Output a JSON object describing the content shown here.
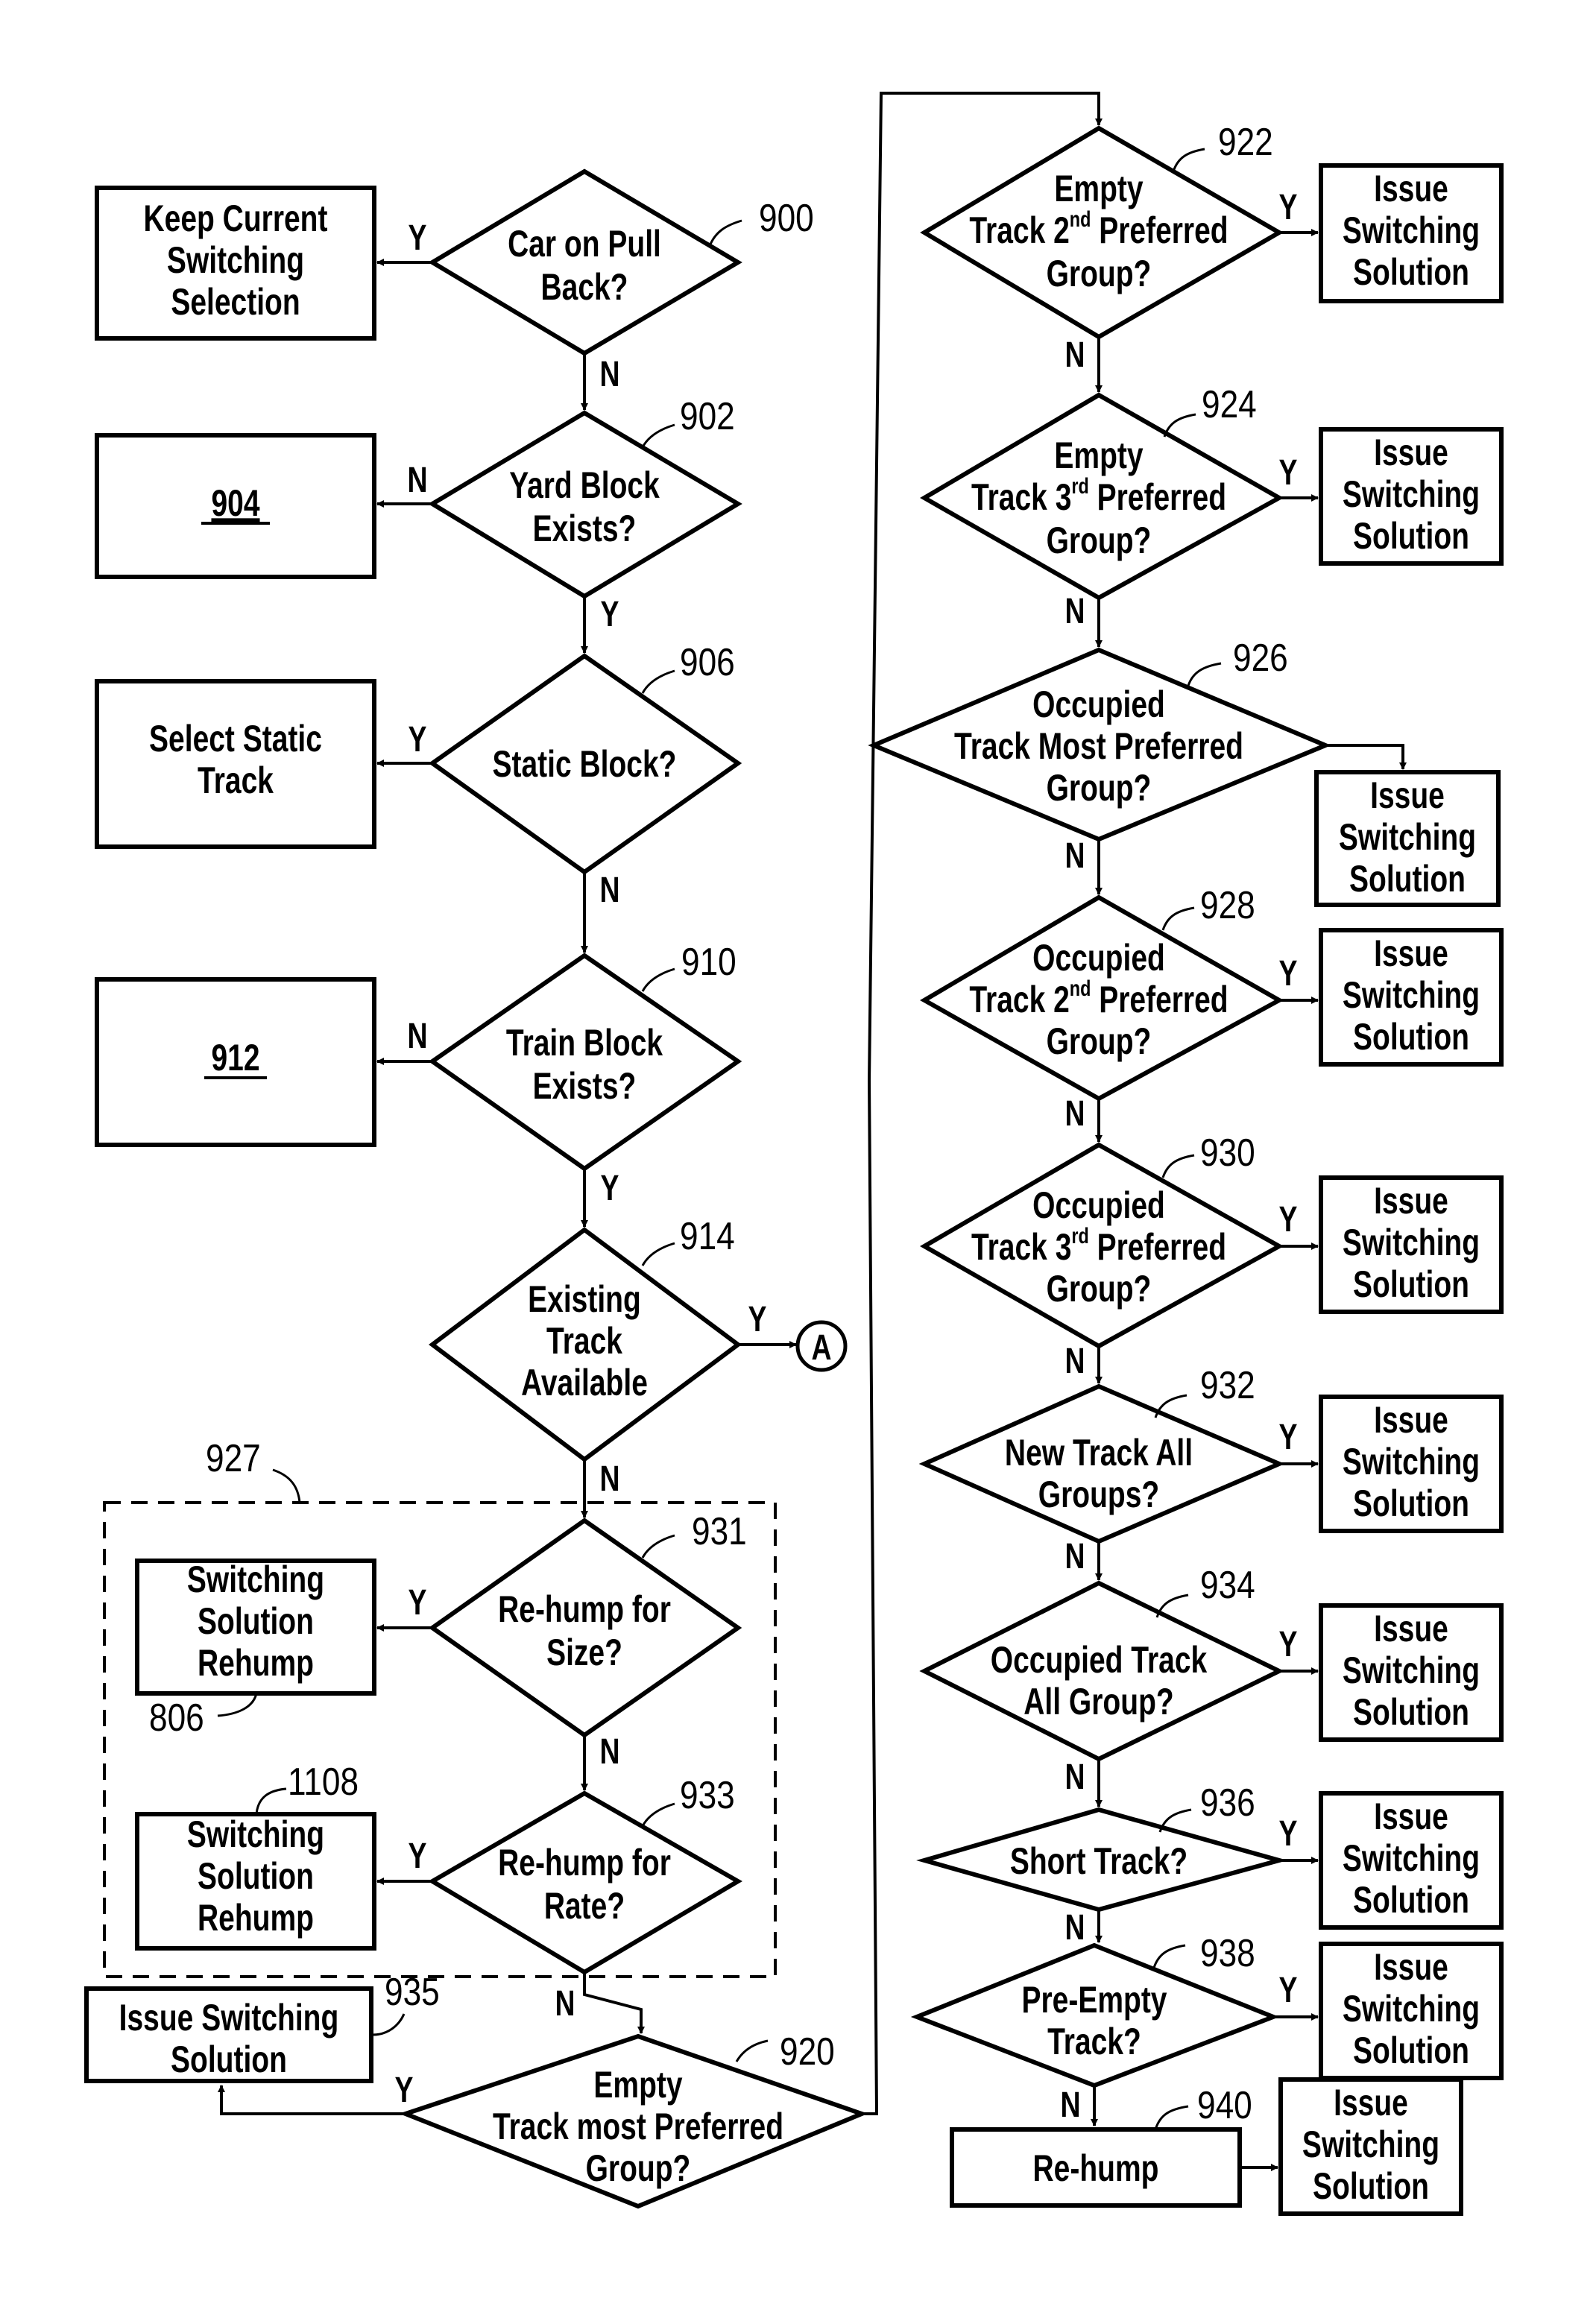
{
  "figure": {
    "type": "flowchart",
    "nodes": {
      "n900": {
        "ref": "900",
        "kind": "decision",
        "lines": [
          "Car on Pull",
          "Back?"
        ]
      },
      "keep_current": {
        "kind": "process",
        "lines": [
          "Keep Current",
          "Switching",
          "Selection"
        ]
      },
      "n902": {
        "ref": "902",
        "kind": "decision",
        "lines": [
          "Yard Block",
          "Exists?"
        ]
      },
      "n904": {
        "ref": "904",
        "kind": "process",
        "label": "904"
      },
      "n906": {
        "ref": "906",
        "kind": "decision",
        "lines": [
          "Static Block?"
        ]
      },
      "select_static": {
        "kind": "process",
        "lines": [
          "Select Static",
          "Track"
        ]
      },
      "n910": {
        "ref": "910",
        "kind": "decision",
        "lines": [
          "Train Block",
          "Exists?"
        ]
      },
      "n912": {
        "ref": "912",
        "kind": "process",
        "label": "912"
      },
      "n914": {
        "ref": "914",
        "kind": "decision",
        "lines": [
          "Existing",
          "Track",
          "Available"
        ]
      },
      "connector_a": {
        "kind": "connector",
        "label": "A"
      },
      "group927": {
        "ref": "927",
        "kind": "group"
      },
      "n931": {
        "ref": "931",
        "kind": "decision",
        "lines": [
          "Re-hump for",
          "Size?"
        ]
      },
      "n806": {
        "ref": "806",
        "kind": "process",
        "lines": [
          "Switching",
          "Solution",
          "Rehump"
        ]
      },
      "n933": {
        "ref": "933",
        "kind": "decision",
        "lines": [
          "Re-hump for",
          "Rate?"
        ]
      },
      "n1108": {
        "ref": "1108",
        "kind": "process",
        "lines": [
          "Switching",
          "Solution",
          "Rehump"
        ]
      },
      "n935": {
        "ref": "935",
        "kind": "process",
        "lines": [
          "Issue Switching",
          "Solution"
        ]
      },
      "n920": {
        "ref": "920",
        "kind": "decision",
        "lines": [
          "Empty",
          "Track most Preferred",
          "Group?"
        ]
      },
      "n922": {
        "ref": "922",
        "kind": "decision",
        "line1": "Empty",
        "line2_pre": "Track 2",
        "line2_sup": "nd",
        "line2_post": " Preferred",
        "line3": "Group?"
      },
      "n924": {
        "ref": "924",
        "kind": "decision",
        "line1": "Empty",
        "line2_pre": "Track 3",
        "line2_sup": "rd",
        "line2_post": " Preferred",
        "line3": "Group?"
      },
      "n926": {
        "ref": "926",
        "kind": "decision",
        "lines": [
          "Occupied",
          "Track Most Preferred",
          "Group?"
        ]
      },
      "n928": {
        "ref": "928",
        "kind": "decision",
        "line1": "Occupied",
        "line2_pre": "Track 2",
        "line2_sup": "nd",
        "line2_post": " Preferred",
        "line3": "Group?"
      },
      "n930": {
        "ref": "930",
        "kind": "decision",
        "line1": "Occupied",
        "line2_pre": "Track 3",
        "line2_sup": "rd",
        "line2_post": " Preferred",
        "line3": "Group?"
      },
      "n932": {
        "ref": "932",
        "kind": "decision",
        "lines": [
          "New Track All",
          "Groups?"
        ]
      },
      "n934": {
        "ref": "934",
        "kind": "decision",
        "lines": [
          "Occupied Track",
          "All Group?"
        ]
      },
      "n936": {
        "ref": "936",
        "kind": "decision",
        "lines": [
          "Short Track?"
        ]
      },
      "n938": {
        "ref": "938",
        "kind": "decision",
        "lines": [
          "Pre-Empty",
          "Track?"
        ]
      },
      "n940": {
        "ref": "940",
        "kind": "process",
        "lines": [
          "Re-hump"
        ]
      },
      "issue_box": {
        "kind": "process",
        "lines": [
          "Issue",
          "Switching",
          "Solution"
        ]
      }
    },
    "edge_labels": {
      "yes": "Y",
      "no": "N"
    }
  }
}
